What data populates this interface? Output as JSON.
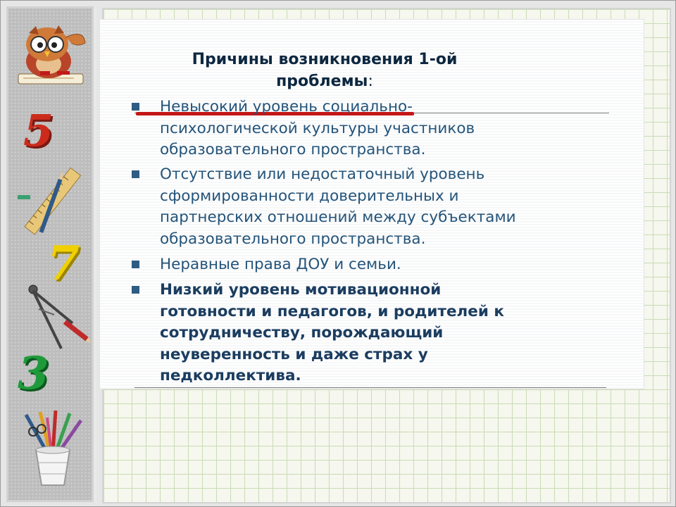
{
  "slide": {
    "title_line1": "Причины возникновения 1-ой",
    "title_line2": "проблемы",
    "title_colon": ":",
    "items": [
      {
        "lines": [
          "Невысокий уровень социально-",
          "психологической культуры участников",
          "образовательного пространства."
        ]
      },
      {
        "lines": [
          "Отсутствие или недостаточный уровень",
          "сформированности доверительных и",
          "партнерских отношений между субъектами",
          "образовательного пространства."
        ]
      },
      {
        "lines": [
          "Неравные права ДОУ и семьи."
        ]
      },
      {
        "lines": [
          "Низкий уровень мотивационной",
          "готовности и педагогов, и  родителей к",
          "сотрудничеству, порождающий",
          "неуверенность и даже страх у",
          "педколлектива."
        ]
      }
    ]
  },
  "decor": {
    "digits": [
      "5",
      "7",
      "3"
    ],
    "icons": [
      "owl-icon",
      "ruler-pencil-icon",
      "compass-icon",
      "pencil-cup-icon"
    ]
  },
  "colors": {
    "title": "#0d2740",
    "text": "#24547a",
    "accent_red": "#c41616",
    "digit_5": "#cc2b1b",
    "digit_7": "#f0d000",
    "digit_3": "#1f9a3b"
  }
}
